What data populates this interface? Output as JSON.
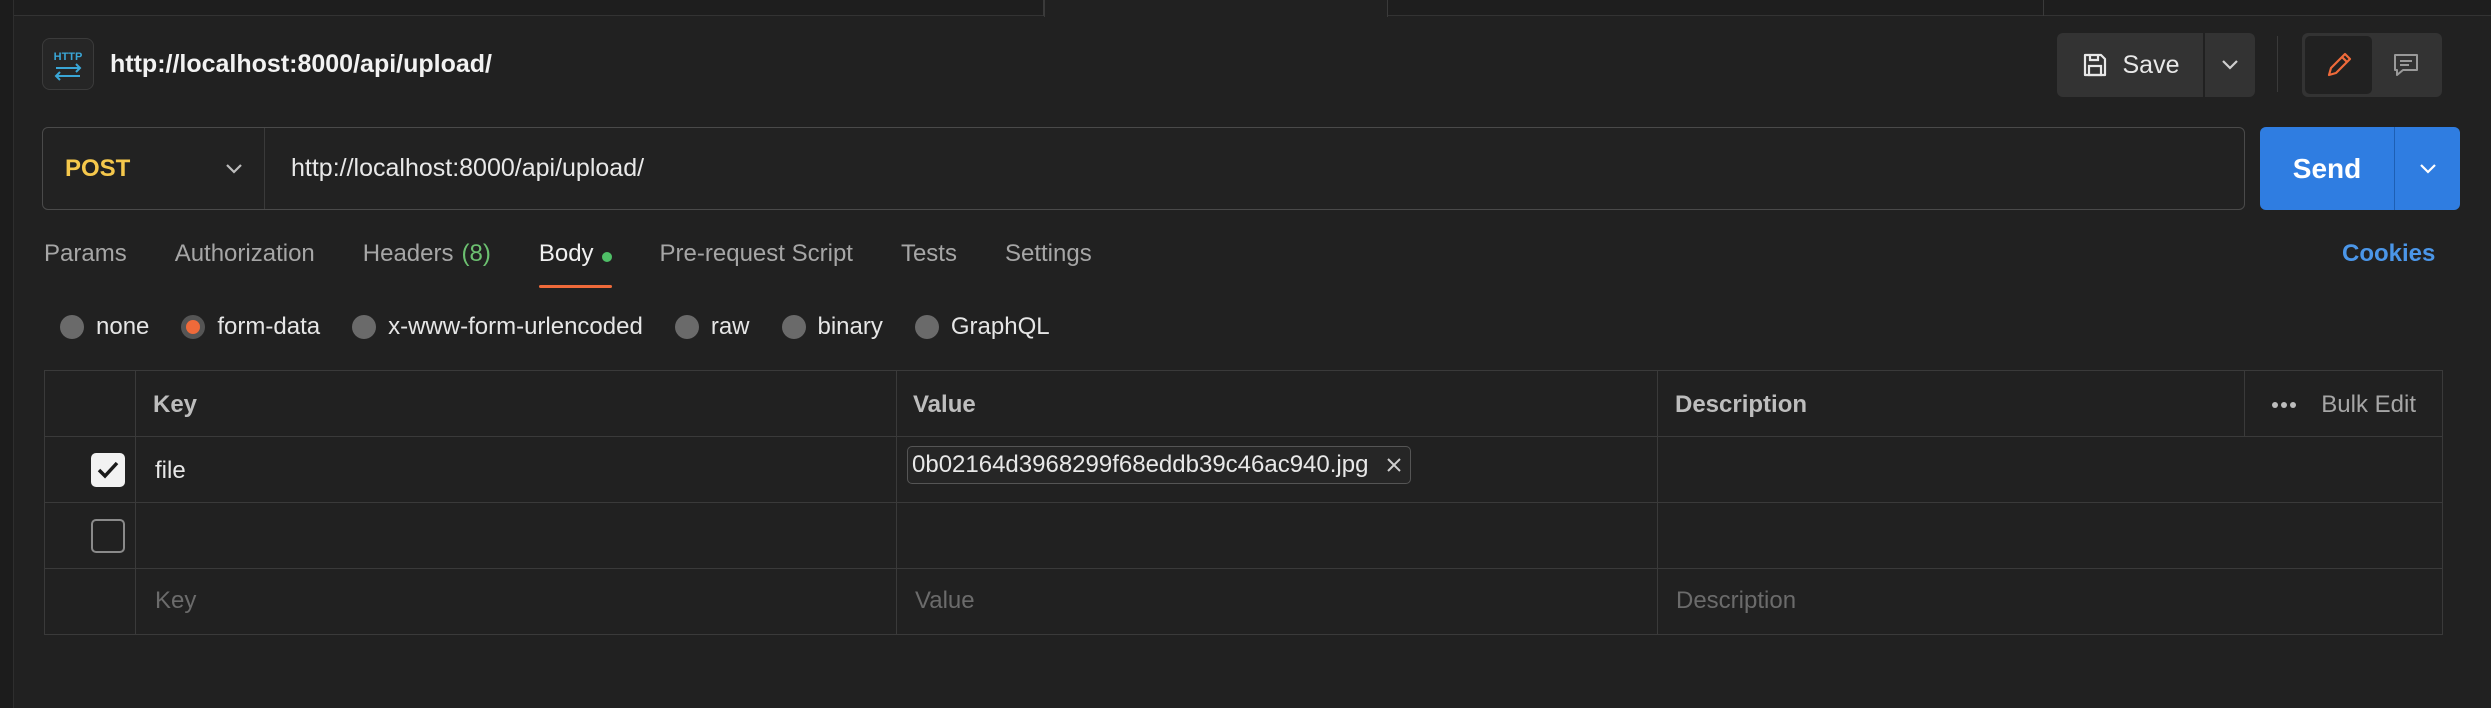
{
  "header": {
    "request_name": "http://localhost:8000/api/upload/",
    "save_label": "Save"
  },
  "request": {
    "method": "POST",
    "url": "http://localhost:8000/api/upload/",
    "send_label": "Send"
  },
  "tabs": [
    {
      "label": "Params"
    },
    {
      "label": "Authorization"
    },
    {
      "label": "Headers",
      "count": "(8)"
    },
    {
      "label": "Body",
      "active": true
    },
    {
      "label": "Pre-request Script"
    },
    {
      "label": "Tests"
    },
    {
      "label": "Settings"
    }
  ],
  "cookies_label": "Cookies",
  "body_types": [
    {
      "label": "none"
    },
    {
      "label": "form-data",
      "selected": true
    },
    {
      "label": "x-www-form-urlencoded"
    },
    {
      "label": "raw"
    },
    {
      "label": "binary"
    },
    {
      "label": "GraphQL"
    }
  ],
  "table": {
    "headers": {
      "key": "Key",
      "value": "Value",
      "description": "Description",
      "bulk_edit": "Bulk Edit"
    },
    "rows": [
      {
        "checked": true,
        "key": "file",
        "value": "0b02164d3968299f68eddb39c46ac940.jpg"
      }
    ],
    "placeholders": {
      "key": "Key",
      "value": "Value",
      "description": "Description"
    }
  },
  "colors": {
    "accent_orange": "#ef6a3a",
    "send_blue": "#2f7de1",
    "method_yellow": "#f5c84c",
    "cookies_blue": "#4b96e8"
  }
}
